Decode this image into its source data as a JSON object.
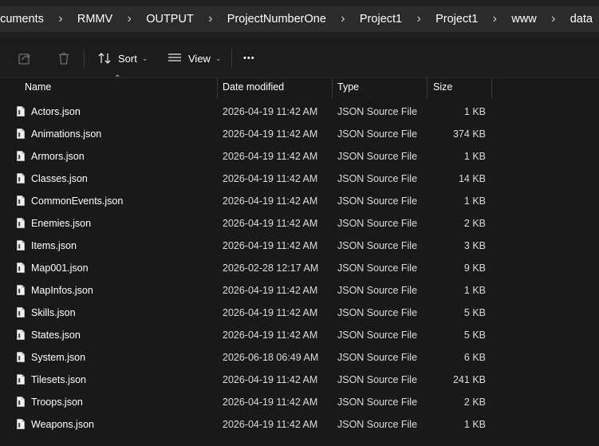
{
  "breadcrumb": {
    "items": [
      "ocuments",
      "RMMV",
      "OUTPUT",
      "ProjectNumberOne",
      "Project1",
      "Project1",
      "www",
      "data"
    ],
    "separator": "›"
  },
  "toolbar": {
    "share_icon": "share-icon",
    "delete_icon": "trash-icon",
    "sort_label": "Sort",
    "view_label": "View",
    "more_label": "•••"
  },
  "columns": {
    "name": "Name",
    "date": "Date modified",
    "type": "Type",
    "size": "Size"
  },
  "files": [
    {
      "name": "Actors.json",
      "date": "2026-04-19 11:42 AM",
      "type": "JSON Source File",
      "size": "1 KB"
    },
    {
      "name": "Animations.json",
      "date": "2026-04-19 11:42 AM",
      "type": "JSON Source File",
      "size": "374 KB"
    },
    {
      "name": "Armors.json",
      "date": "2026-04-19 11:42 AM",
      "type": "JSON Source File",
      "size": "1 KB"
    },
    {
      "name": "Classes.json",
      "date": "2026-04-19 11:42 AM",
      "type": "JSON Source File",
      "size": "14 KB"
    },
    {
      "name": "CommonEvents.json",
      "date": "2026-04-19 11:42 AM",
      "type": "JSON Source File",
      "size": "1 KB"
    },
    {
      "name": "Enemies.json",
      "date": "2026-04-19 11:42 AM",
      "type": "JSON Source File",
      "size": "2 KB"
    },
    {
      "name": "Items.json",
      "date": "2026-04-19 11:42 AM",
      "type": "JSON Source File",
      "size": "3 KB"
    },
    {
      "name": "Map001.json",
      "date": "2026-02-28 12:17 AM",
      "type": "JSON Source File",
      "size": "9 KB"
    },
    {
      "name": "MapInfos.json",
      "date": "2026-04-19 11:42 AM",
      "type": "JSON Source File",
      "size": "1 KB"
    },
    {
      "name": "Skills.json",
      "date": "2026-04-19 11:42 AM",
      "type": "JSON Source File",
      "size": "5 KB"
    },
    {
      "name": "States.json",
      "date": "2026-04-19 11:42 AM",
      "type": "JSON Source File",
      "size": "5 KB"
    },
    {
      "name": "System.json",
      "date": "2026-06-18 06:49 AM",
      "type": "JSON Source File",
      "size": "6 KB"
    },
    {
      "name": "Tilesets.json",
      "date": "2026-04-19 11:42 AM",
      "type": "JSON Source File",
      "size": "241 KB"
    },
    {
      "name": "Troops.json",
      "date": "2026-04-19 11:42 AM",
      "type": "JSON Source File",
      "size": "2 KB"
    },
    {
      "name": "Weapons.json",
      "date": "2026-04-19 11:42 AM",
      "type": "JSON Source File",
      "size": "1 KB"
    }
  ],
  "colors": {
    "background": "#191919",
    "breadcrumb_bg": "#2b2b2b",
    "text": "#ffffff"
  }
}
